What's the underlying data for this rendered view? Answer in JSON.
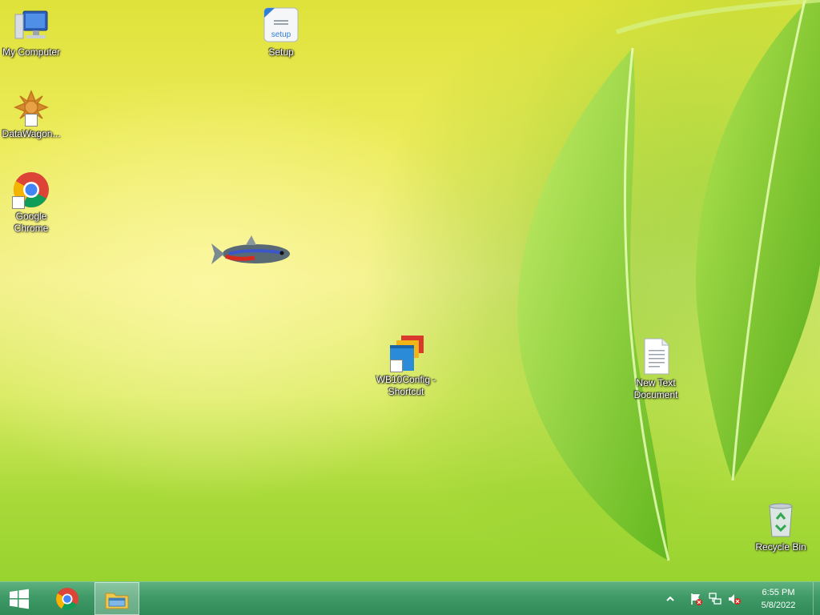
{
  "desktop_icons": {
    "my_computer": {
      "label": "My Computer",
      "icon": "computer-icon"
    },
    "setup": {
      "label": "Setup",
      "icon": "setup-icon"
    },
    "datawagon": {
      "label": "DataWagon...",
      "icon": "datawagon-icon"
    },
    "chrome": {
      "label": "Google Chrome",
      "icon": "chrome-icon"
    },
    "wb10config": {
      "label": "WB10Config - Shortcut",
      "icon": "wb10config-icon"
    },
    "new_text": {
      "label": "New Text Document",
      "icon": "text-document-icon"
    },
    "recycle_bin": {
      "label": "Recycle Bin",
      "icon": "recycle-bin-icon"
    }
  },
  "taskbar": {
    "start_icon": "windows-logo-icon",
    "pinned": [
      "chrome-icon",
      "file-explorer-icon"
    ],
    "tray_icons": [
      "chevron-up-icon",
      "action-center-flag-icon",
      "network-icon",
      "volume-muted-icon"
    ],
    "clock": {
      "time": "6:55 PM",
      "date": "5/8/2022"
    }
  },
  "colors": {
    "taskbar": "#3f9a67",
    "desktop": "#e6e84e"
  }
}
